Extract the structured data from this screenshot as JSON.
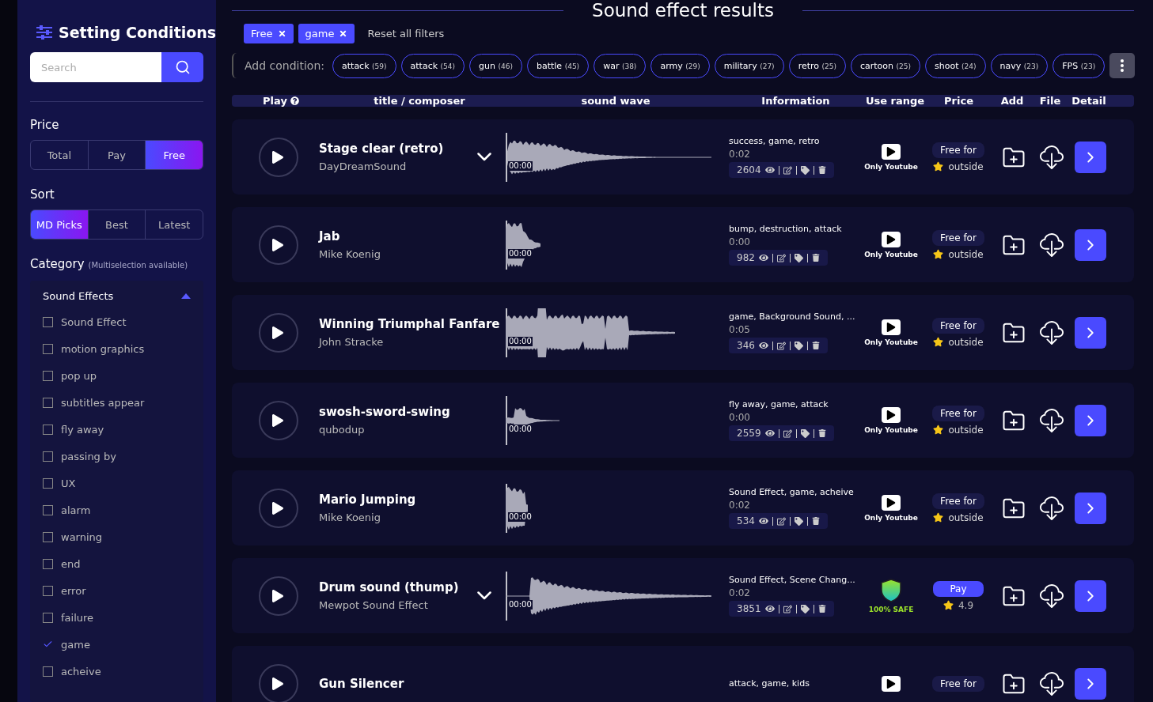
{
  "sidebar": {
    "title": "Setting Conditions",
    "search": {
      "placeholder": "Search"
    },
    "price": {
      "label": "Price",
      "options": [
        {
          "label": "Total",
          "selected": false
        },
        {
          "label": "Pay",
          "selected": false
        },
        {
          "label": "Free",
          "selected": true
        }
      ]
    },
    "sort": {
      "label": "Sort",
      "options": [
        {
          "label": "MD Picks",
          "selected": true
        },
        {
          "label": "Best",
          "selected": false
        },
        {
          "label": "Latest",
          "selected": false
        }
      ]
    },
    "category": {
      "label": "Category",
      "hint": "(Multiselection available)",
      "group": {
        "label": "Sound Effects",
        "expanded": true,
        "items": [
          {
            "label": "Sound Effect",
            "checked": false
          },
          {
            "label": "motion graphics",
            "checked": false
          },
          {
            "label": "pop up",
            "checked": false
          },
          {
            "label": "subtitles appear",
            "checked": false
          },
          {
            "label": "fly away",
            "checked": false
          },
          {
            "label": "passing by",
            "checked": false
          },
          {
            "label": "UX",
            "checked": false
          },
          {
            "label": "alarm",
            "checked": false
          },
          {
            "label": "warning",
            "checked": false
          },
          {
            "label": "end",
            "checked": false
          },
          {
            "label": "error",
            "checked": false
          },
          {
            "label": "failure",
            "checked": false
          },
          {
            "label": "game",
            "checked": true
          },
          {
            "label": "acheive",
            "checked": false
          }
        ]
      }
    }
  },
  "main": {
    "title": "Sound effect results",
    "active_filters": [
      "Free",
      "game"
    ],
    "reset_label": "Reset all filters",
    "add_condition_label": "Add condition:",
    "conditions": [
      {
        "label": "attack",
        "count": "(59)"
      },
      {
        "label": "attack",
        "count": "(54)"
      },
      {
        "label": "gun",
        "count": "(46)"
      },
      {
        "label": "battle",
        "count": "(45)"
      },
      {
        "label": "war",
        "count": "(38)"
      },
      {
        "label": "army",
        "count": "(29)"
      },
      {
        "label": "military",
        "count": "(27)"
      },
      {
        "label": "retro",
        "count": "(25)"
      },
      {
        "label": "cartoon",
        "count": "(25)"
      },
      {
        "label": "shoot",
        "count": "(24)"
      },
      {
        "label": "navy",
        "count": "(23)"
      },
      {
        "label": "FPS",
        "count": "(23)"
      }
    ],
    "columns": [
      "Play",
      "title / composer",
      "sound wave",
      "Information",
      "Use range",
      "Price",
      "Add",
      "File",
      "Detail"
    ],
    "rows": [
      {
        "title": "Stage clear (retro)",
        "composer": "DayDreamSound",
        "has_versions": true,
        "waveform": {
          "kind": "decay",
          "time": "00:00"
        },
        "tags": "success, game, retro",
        "duration": "0:02",
        "views": "2604",
        "use_range": {
          "kind": "youtube",
          "label": "Only Youtube"
        },
        "price": {
          "kind": "free",
          "label": "Free for",
          "note": "outside"
        }
      },
      {
        "title": "Jab",
        "composer": "Mike Koenig",
        "has_versions": false,
        "waveform": {
          "kind": "short",
          "time": "00:00"
        },
        "tags": "bump, destruction, attack",
        "duration": "0:00",
        "views": "982",
        "use_range": {
          "kind": "youtube",
          "label": "Only Youtube"
        },
        "price": {
          "kind": "free",
          "label": "Free for",
          "note": "outside"
        }
      },
      {
        "title": "Winning Triumphal Fanfare",
        "composer": "John Stracke",
        "has_versions": false,
        "waveform": {
          "kind": "blocks",
          "time": "00:00"
        },
        "tags": "game, Background Sound, ...",
        "duration": "0:05",
        "views": "346",
        "use_range": {
          "kind": "youtube",
          "label": "Only Youtube"
        },
        "price": {
          "kind": "free",
          "label": "Free for",
          "note": "outside"
        }
      },
      {
        "title": "swosh-sword-swing",
        "composer": "qubodup",
        "has_versions": false,
        "waveform": {
          "kind": "spike",
          "time": "00:00"
        },
        "tags": "fly away, game, attack",
        "duration": "0:00",
        "views": "2559",
        "use_range": {
          "kind": "youtube",
          "label": "Only Youtube"
        },
        "price": {
          "kind": "free",
          "label": "Free for",
          "note": "outside"
        }
      },
      {
        "title": "Mario Jumping",
        "composer": "Mike Koenig",
        "has_versions": false,
        "waveform": {
          "kind": "block",
          "time": "00:00"
        },
        "tags": "Sound Effect, game, acheive",
        "duration": "0:02",
        "views": "534",
        "use_range": {
          "kind": "youtube",
          "label": "Only Youtube"
        },
        "price": {
          "kind": "free",
          "label": "Free for",
          "note": "outside"
        }
      },
      {
        "title": "Drum sound (thump)",
        "composer": "Mewpot Sound Effect",
        "has_versions": true,
        "waveform": {
          "kind": "late",
          "time": "00:00"
        },
        "tags": "Sound Effect, Scene Chang...",
        "duration": "0:02",
        "views": "3851",
        "use_range": {
          "kind": "safe",
          "label": "100% SAFE"
        },
        "price": {
          "kind": "pay",
          "label": "Pay",
          "rating": "4.9"
        }
      },
      {
        "title": "Gun Silencer",
        "has_versions": false,
        "tags": "attack, game, kids",
        "use_range": {
          "kind": "youtube"
        },
        "price": {
          "kind": "free",
          "label": "Free for"
        }
      }
    ]
  }
}
